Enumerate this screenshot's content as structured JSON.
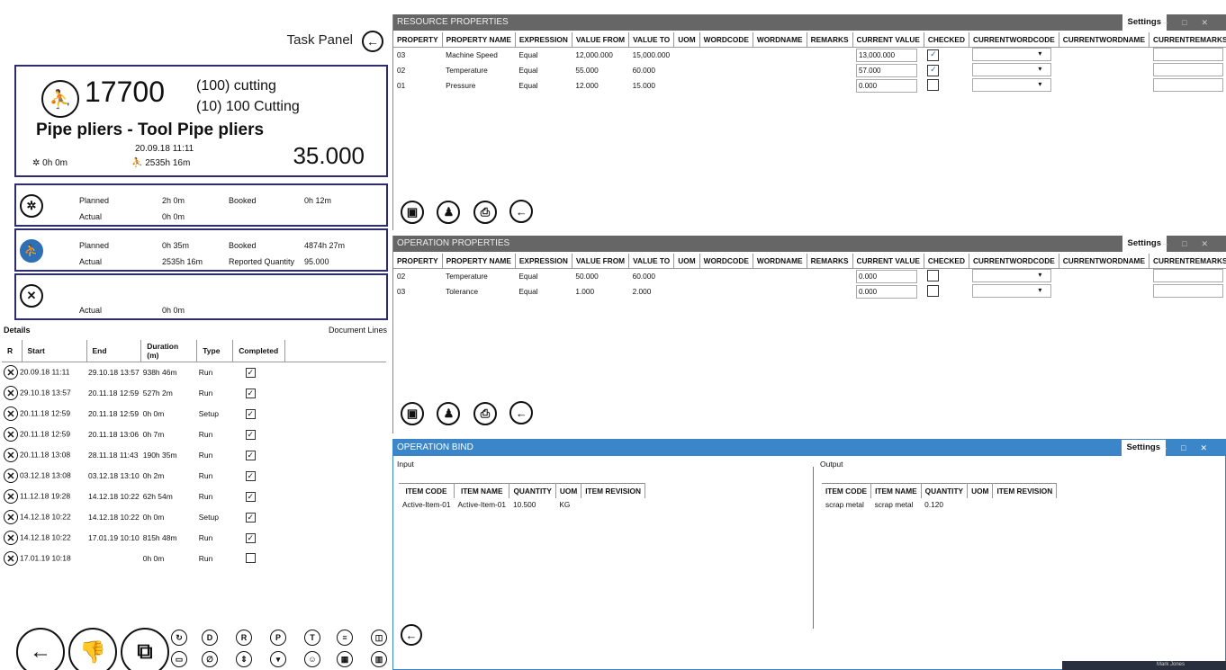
{
  "task_panel": {
    "title": "Task Panel",
    "card": {
      "quantity": "17700",
      "op_line1": "(100) cutting",
      "op_line2": "(10) 100 Cutting",
      "name": "Pipe pliers - Tool Pipe pliers",
      "date": "20.09.18 11:11",
      "setup_time": "0h 0m",
      "run_time": "2535h 16m",
      "big_qty": "35.000"
    },
    "rows": [
      {
        "planned_label": "Planned",
        "planned": "2h 0m",
        "booked_label": "Booked",
        "booked": "0h 12m",
        "actual_label": "Actual",
        "actual": "0h 0m",
        "icon": "gear-icon"
      },
      {
        "planned_label": "Planned",
        "planned": "0h 35m",
        "booked_label": "Booked",
        "booked": "4874h 27m",
        "actual_label": "Actual",
        "actual": "2535h 16m",
        "reported_label": "Reported Quantity",
        "reported": "95.000",
        "icon": "worker-icon"
      },
      {
        "actual_label": "Actual",
        "actual": "0h 0m",
        "icon": "tools-icon"
      }
    ],
    "details_label": "Details",
    "document_lines_label": "Document Lines",
    "columns": [
      "R",
      "Start",
      "End",
      "Duration (m)",
      "Type",
      "Completed"
    ],
    "details": [
      {
        "start": "20.09.18 11:11",
        "end": "29.10.18 13:57",
        "duration": "938h 46m",
        "type": "Run",
        "completed": true
      },
      {
        "start": "29.10.18 13:57",
        "end": "20.11.18 12:59",
        "duration": "527h 2m",
        "type": "Run",
        "completed": true
      },
      {
        "start": "20.11.18 12:59",
        "end": "20.11.18 12:59",
        "duration": "0h 0m",
        "type": "Setup",
        "completed": true
      },
      {
        "start": "20.11.18 12:59",
        "end": "20.11.18 13:06",
        "duration": "0h 7m",
        "type": "Run",
        "completed": true
      },
      {
        "start": "20.11.18 13:08",
        "end": "28.11.18 11:43",
        "duration": "190h 35m",
        "type": "Run",
        "completed": true
      },
      {
        "start": "03.12.18 13:08",
        "end": "03.12.18 13:10",
        "duration": "0h 2m",
        "type": "Run",
        "completed": true
      },
      {
        "start": "11.12.18 19:28",
        "end": "14.12.18 10:22",
        "duration": "62h 54m",
        "type": "Run",
        "completed": true
      },
      {
        "start": "14.12.18 10:22",
        "end": "14.12.18 10:22",
        "duration": "0h 0m",
        "type": "Setup",
        "completed": true
      },
      {
        "start": "14.12.18 10:22",
        "end": "17.01.19 10:10",
        "duration": "815h 48m",
        "type": "Run",
        "completed": true
      },
      {
        "start": "17.01.19 10:18",
        "end": "",
        "duration": "0h 0m",
        "type": "Run",
        "completed": false
      }
    ]
  },
  "resource_panel": {
    "title": "RESOURCE PROPERTIES",
    "settings": "Settings",
    "columns": [
      "PROPERTY",
      "PROPERTY NAME",
      "EXPRESSION",
      "VALUE FROM",
      "VALUE TO",
      "UOM",
      "WORDCODE",
      "WORDNAME",
      "REMARKS",
      "CURRENT VALUE",
      "CHECKED",
      "CURRENTWORDCODE",
      "CURRENTWORDNAME",
      "CURRENTREMARKS"
    ],
    "rows": [
      {
        "property": "03",
        "name": "Machine Speed",
        "expression": "Equal",
        "from": "12,000.000",
        "to": "15,000.000",
        "current": "13,000.000",
        "checked": true
      },
      {
        "property": "02",
        "name": "Temperature",
        "expression": "Equal",
        "from": "55.000",
        "to": "60.000",
        "current": "57.000",
        "checked": true
      },
      {
        "property": "01",
        "name": "Pressure",
        "expression": "Equal",
        "from": "12.000",
        "to": "15.000",
        "current": "0.000",
        "checked": false
      }
    ]
  },
  "operation_panel": {
    "title": "OPERATION PROPERTIES",
    "settings": "Settings",
    "columns": [
      "PROPERTY",
      "PROPERTY NAME",
      "EXPRESSION",
      "VALUE FROM",
      "VALUE TO",
      "UOM",
      "WORDCODE",
      "WORDNAME",
      "REMARKS",
      "CURRENT VALUE",
      "CHECKED",
      "CURRENTWORDCODE",
      "CURRENTWORDNAME",
      "CURRENTREMARKS"
    ],
    "rows": [
      {
        "property": "02",
        "name": "Temperature",
        "expression": "Equal",
        "from": "50.000",
        "to": "60.000",
        "current": "0.000",
        "checked": false
      },
      {
        "property": "03",
        "name": "Tolerance",
        "expression": "Equal",
        "from": "1.000",
        "to": "2.000",
        "current": "0.000",
        "checked": false
      }
    ]
  },
  "bind_panel": {
    "title": "OPERATION BIND",
    "settings": "Settings",
    "input_label": "Input",
    "output_label": "Output",
    "columns": [
      "ITEM CODE",
      "ITEM NAME",
      "QUANTITY",
      "UOM",
      "ITEM REVISION"
    ],
    "input_rows": [
      {
        "code": "Active-Item-01",
        "name": "Active-Item-01",
        "qty": "10.500",
        "uom": "KG",
        "rev": ""
      }
    ],
    "output_rows": [
      {
        "code": "scrap metal",
        "name": "scrap metal",
        "qty": "0.120",
        "uom": "",
        "rev": ""
      }
    ]
  },
  "status": {
    "user": "Mark Jones"
  },
  "colors": {
    "accent": "#3a86c8",
    "title_bar": "#666666",
    "card_border": "#2c2c6e"
  }
}
